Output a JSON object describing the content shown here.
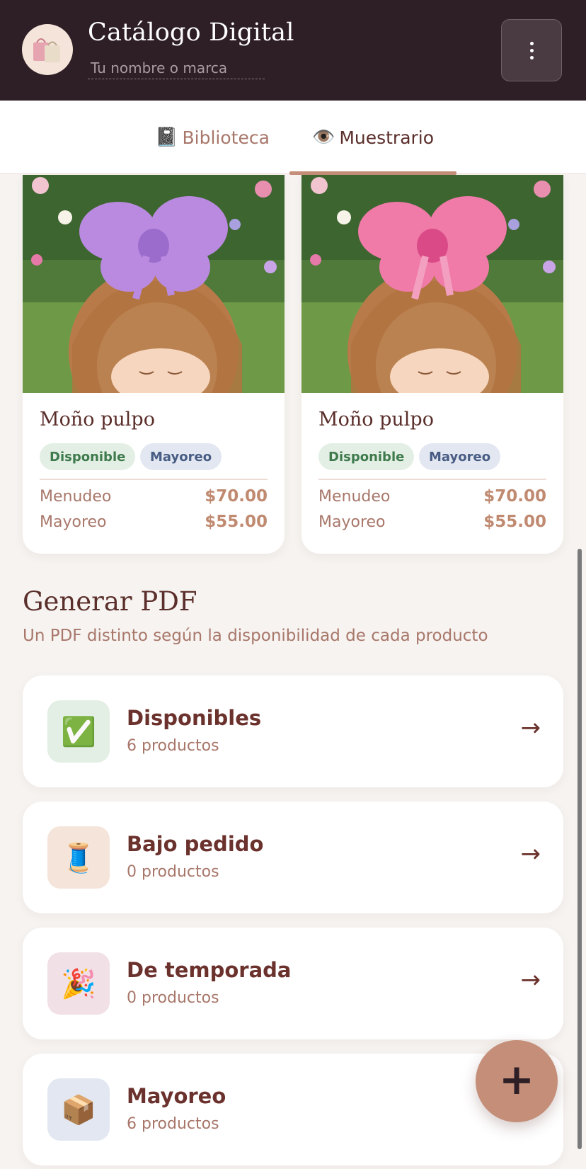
{
  "header": {
    "title": "Catálogo Digital",
    "brand_placeholder": "Tu nombre o marca",
    "logo_icon": "shopping-bags-icon",
    "menu_icon": "kebab-menu-icon"
  },
  "tabs": [
    {
      "icon": "📓",
      "label": "Biblioteca",
      "active": false
    },
    {
      "icon": "👁️",
      "label": "Muestrario",
      "active": true
    }
  ],
  "products": [
    {
      "name": "Moño pulpo",
      "bow_color": "#b98ae0",
      "tags": [
        "Disponible",
        "Mayoreo"
      ],
      "prices": [
        {
          "label": "Menudeo",
          "value": "$70.00"
        },
        {
          "label": "Mayoreo",
          "value": "$55.00"
        }
      ]
    },
    {
      "name": "Moño pulpo",
      "bow_color": "#f07aa8",
      "tags": [
        "Disponible",
        "Mayoreo"
      ],
      "prices": [
        {
          "label": "Menudeo",
          "value": "$70.00"
        },
        {
          "label": "Mayoreo",
          "value": "$55.00"
        }
      ]
    }
  ],
  "pdf_section": {
    "title": "Generar PDF",
    "subtitle": "Un PDF distinto según la disponibilidad de cada producto",
    "categories": [
      {
        "icon": "✅",
        "icon_bg": "#e3efe4",
        "title": "Disponibles",
        "count": "6 productos"
      },
      {
        "icon": "🧵",
        "icon_bg": "#f5e4d9",
        "title": "Bajo pedido",
        "count": "0 productos"
      },
      {
        "icon": "🎉",
        "icon_bg": "#f1e0e6",
        "title": "De temporada",
        "count": "0 productos"
      },
      {
        "icon": "📦",
        "icon_bg": "#e2e7f1",
        "title": "Mayoreo",
        "count": "6 productos"
      }
    ],
    "arrow": "→"
  },
  "fab": {
    "label": "+",
    "color": "#c48e78"
  },
  "colors": {
    "header_bg": "#2e1f27",
    "accent": "#c48e78",
    "text_primary": "#5a2e2a",
    "text_muted": "#a8776a"
  }
}
